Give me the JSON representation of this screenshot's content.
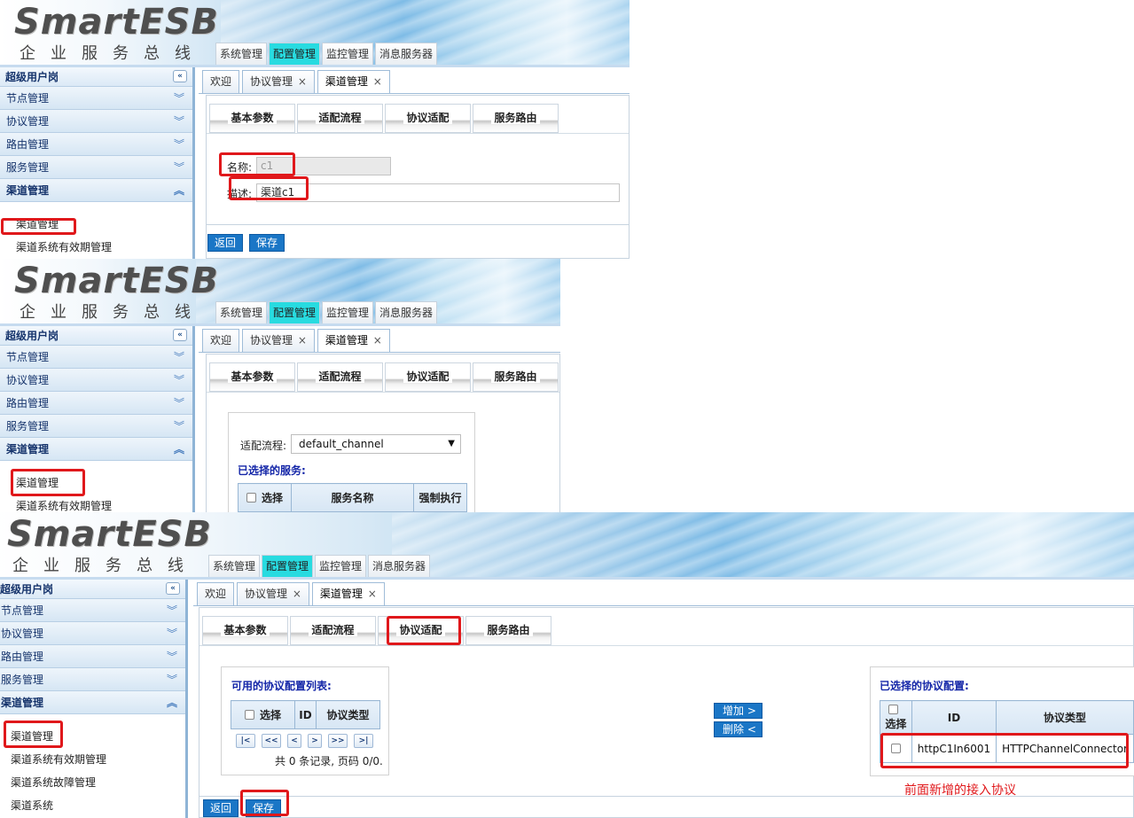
{
  "app": {
    "logo": "SmartESB",
    "slogan": "企业服务总线",
    "top_nav": [
      "系统管理",
      "配置管理",
      "监控管理",
      "消息服务器"
    ],
    "top_nav_active": "配置管理"
  },
  "sidebar": {
    "title": "超级用户岗",
    "sections": [
      "节点管理",
      "协议管理",
      "路由管理",
      "服务管理",
      "渠道管理"
    ],
    "open_section": "渠道管理",
    "channel_items": [
      "渠道管理",
      "渠道系统有效期管理",
      "渠道系统故障管理",
      "渠道系统"
    ]
  },
  "tabs": [
    {
      "label": "欢迎",
      "closable": false
    },
    {
      "label": "协议管理",
      "closable": true
    },
    {
      "label": "渠道管理",
      "closable": true,
      "active": true
    }
  ],
  "tab_close_glyph": "×",
  "subtabs": [
    "基本参数",
    "适配流程",
    "协议适配",
    "服务路由"
  ],
  "panel1": {
    "active_subtab": "基本参数",
    "name_label": "名称:",
    "name_value": "c1",
    "desc_label": "描述:",
    "desc_value": "渠道c1",
    "back_button": "返回",
    "save_button": "保存"
  },
  "panel2": {
    "active_subtab": "适配流程",
    "flow_label": "适配流程:",
    "flow_value": "default_channel",
    "selected_services_title": "已选择的服务:",
    "table_headers": [
      "选择",
      "服务名称",
      "强制执行"
    ]
  },
  "panel3": {
    "active_subtab": "协议适配",
    "available_title": "可用的协议配置列表:",
    "available_headers": [
      "选择",
      "ID",
      "协议类型"
    ],
    "available_rows": [],
    "pager_buttons": [
      "|<",
      "<<",
      "<",
      ">",
      ">>",
      ">|"
    ],
    "pager_text": "共 0 条记录, 页码 0/0.",
    "add_button": "增加 >",
    "remove_button": "删除 <",
    "selected_title": "已选择的协议配置:",
    "selected_headers": [
      "选择",
      "ID",
      "协议类型"
    ],
    "selected_rows": [
      {
        "id": "httpC1In6001",
        "type": "HTTPChannelConnector"
      }
    ],
    "annotation": "前面新增的接入协议",
    "back_button": "返回",
    "save_button": "保存"
  },
  "colors": {
    "accent_blue": "#1a76c6",
    "active_nav": "#28dbe0",
    "highlight_red": "#e0181b",
    "section_title_blue": "#1426a8"
  }
}
